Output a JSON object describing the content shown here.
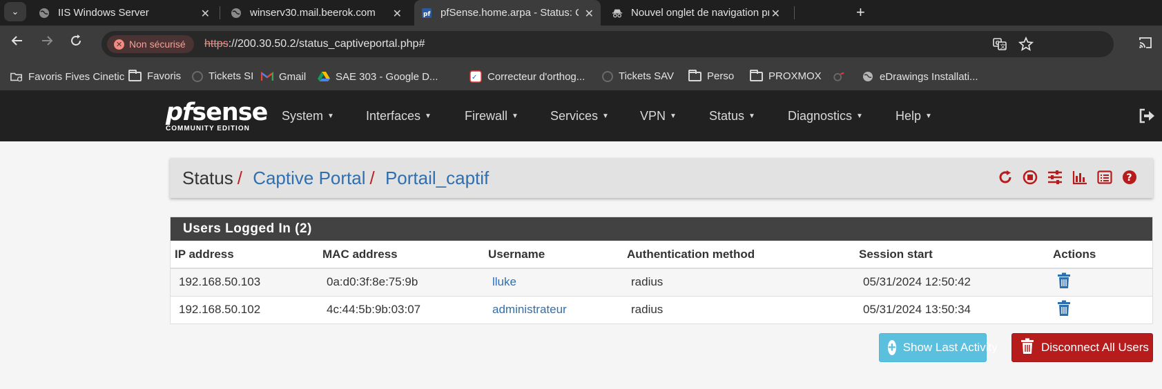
{
  "browser": {
    "tabs": [
      {
        "title": "IIS Windows Server",
        "icon": "globe-icon"
      },
      {
        "title": "winserv30.mail.beerok.com",
        "icon": "globe-icon"
      },
      {
        "title": "pfSense.home.arpa - Status: Cap",
        "icon": "pfsense-icon"
      },
      {
        "title": "Nouvel onglet de navigation pr",
        "icon": "incognito-icon"
      }
    ],
    "security_chip": "Non sécurisé",
    "url_scheme": "https",
    "url_rest": "://200.30.50.2/status_captiveportal.php#",
    "bookmarks": [
      {
        "label": "Favoris Fives Cinetic",
        "icon": "bookmarks-manager-icon"
      },
      {
        "label": "Favoris",
        "icon": "folder-icon"
      },
      {
        "label": "Tickets SI",
        "icon": "site-icon"
      },
      {
        "label": "Gmail",
        "icon": "gmail-icon"
      },
      {
        "label": "SAE 303 - Google D...",
        "icon": "google-drive-icon"
      },
      {
        "label": "Correcteur d'orthog...",
        "icon": "site-icon"
      },
      {
        "label": "Tickets SAV",
        "icon": "site-icon"
      },
      {
        "label": "Perso",
        "icon": "folder-icon"
      },
      {
        "label": "PROXMOX",
        "icon": "folder-icon"
      },
      {
        "label": "",
        "icon": "site-icon"
      },
      {
        "label": "eDrawings Installati...",
        "icon": "globe-icon"
      }
    ]
  },
  "pfsense": {
    "logo_word_a": "pf",
    "logo_word_b": "sense",
    "logo_edition": "COMMUNITY EDITION",
    "menu": [
      "System",
      "Interfaces",
      "Firewall",
      "Services",
      "VPN",
      "Status",
      "Diagnostics",
      "Help"
    ],
    "breadcrumb": {
      "root": "Status",
      "level1": "Captive Portal",
      "level2": "Portail_captif"
    },
    "panel_title": "Users Logged In (2)",
    "columns": [
      "IP address",
      "MAC address",
      "Username",
      "Authentication method",
      "Session start",
      "Actions"
    ],
    "rows": [
      {
        "ip": "192.168.50.103",
        "mac": "0a:d0:3f:8e:75:9b",
        "user": "lluke",
        "auth": "radius",
        "start": "05/31/2024 12:50:42"
      },
      {
        "ip": "192.168.50.102",
        "mac": "4c:44:5b:9b:03:07",
        "user": "administrateur",
        "auth": "radius",
        "start": "05/31/2024 13:50:34"
      }
    ],
    "btn_show_last": "Show Last Activity",
    "btn_disconnect_all": "Disconnect All Users",
    "colors": {
      "accent_red": "#b71c1c",
      "link_blue": "#2f6fb0",
      "info": "#5bc0de",
      "nav_bg": "#212121"
    }
  }
}
